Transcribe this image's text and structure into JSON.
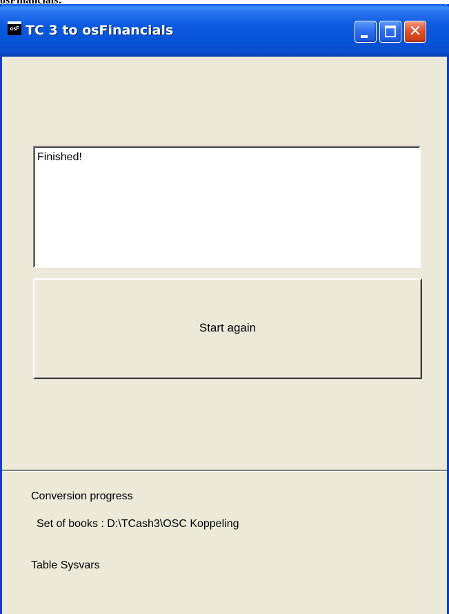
{
  "caption": "osFinancials:",
  "window": {
    "title": "TC 3 to osFinancials",
    "icon_label": "osF",
    "icon": "app-icon",
    "controls": {
      "minimize_icon": "minimize-icon",
      "maximize_icon": "maximize-icon",
      "close_icon": "close-icon"
    }
  },
  "main": {
    "output_text": "Finished!",
    "start_button_label": "Start again"
  },
  "status": {
    "heading": "Conversion progress",
    "set_of_books": "Set of books : D:\\TCash3\\OSC Koppeling",
    "table": "Table Sysvars"
  },
  "colors": {
    "titlebar": "#0553d8",
    "window_bg": "#ece9d8",
    "close_button": "#e3532b"
  }
}
